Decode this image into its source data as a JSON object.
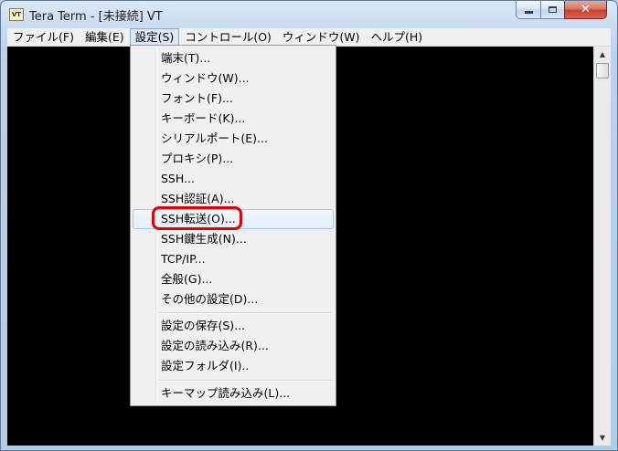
{
  "window": {
    "title": "Tera Term - [未接続] VT",
    "icon": "vt-app-icon",
    "icon_text": "VT"
  },
  "menubar": [
    {
      "label": "ファイル(F)"
    },
    {
      "label": "編集(E)"
    },
    {
      "label": "設定(S)",
      "active": true
    },
    {
      "label": "コントロール(O)"
    },
    {
      "label": "ウィンドウ(W)"
    },
    {
      "label": "ヘルプ(H)"
    }
  ],
  "settings_menu": {
    "group1": [
      "端末(T)...",
      "ウィンドウ(W)...",
      "フォント(F)...",
      "キーボード(K)...",
      "シリアルポート(E)...",
      "プロキシ(P)...",
      "SSH...",
      "SSH認証(A)...",
      "SSH転送(O)...",
      "SSH鍵生成(N)...",
      "TCP/IP...",
      "全般(G)...",
      "その他の設定(D)..."
    ],
    "group2": [
      "設定の保存(S)...",
      "設定の読み込み(R)...",
      "設定フォルダ(I).."
    ],
    "group3": [
      "キーマップ読み込み(L)..."
    ],
    "hovered": "SSH転送(O)...",
    "annotation": "red-rounded-highlight-around-ssh-forwarding"
  },
  "colors": {
    "terminal_bg": "#000000",
    "annotation_red": "#e00000",
    "menu_bg": "#f0f0f0"
  }
}
